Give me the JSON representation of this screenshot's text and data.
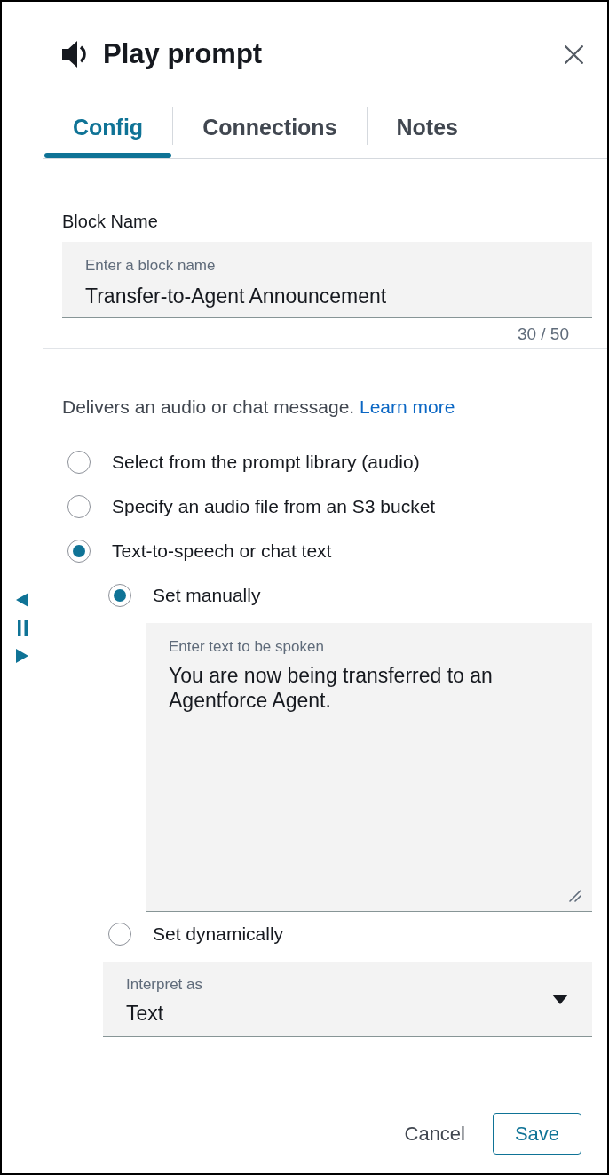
{
  "header": {
    "title": "Play prompt"
  },
  "tabs": [
    {
      "label": "Config",
      "selected": true
    },
    {
      "label": "Connections",
      "selected": false
    },
    {
      "label": "Notes",
      "selected": false
    }
  ],
  "block_name": {
    "label": "Block Name",
    "field_label": "Enter a block name",
    "value": "Transfer-to-Agent Announcement",
    "counter": "30 / 50"
  },
  "description": {
    "text": "Delivers an audio or chat message.",
    "link": "Learn more"
  },
  "options": [
    {
      "label": "Select from the prompt library (audio)",
      "selected": false
    },
    {
      "label": "Specify an audio file from an S3 bucket",
      "selected": false
    },
    {
      "label": "Text-to-speech or chat text",
      "selected": true,
      "sub_options": [
        {
          "label": "Set manually",
          "selected": true,
          "text_field": {
            "field_label": "Enter text to be spoken",
            "value": "You are now being transferred to an Agentforce Agent."
          }
        },
        {
          "label": "Set dynamically",
          "selected": false
        }
      ],
      "interpret_as": {
        "field_label": "Interpret as",
        "value": "Text"
      }
    }
  ],
  "footer": {
    "cancel": "Cancel",
    "save": "Save"
  }
}
